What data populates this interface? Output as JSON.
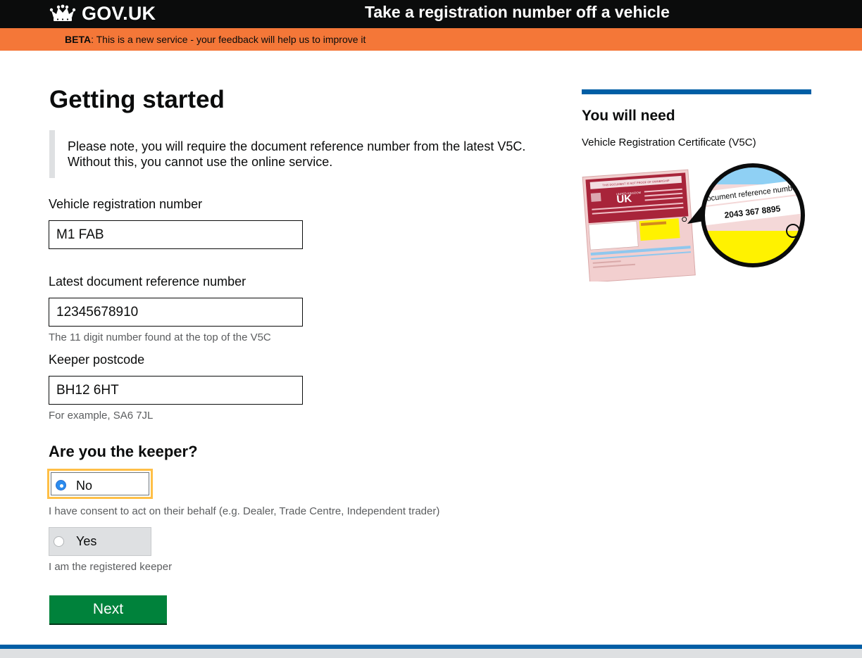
{
  "header": {
    "logo_text": "GOV.UK",
    "logo_icon": "crown-icon",
    "service_name": "Take a registration number off a vehicle"
  },
  "beta_banner": {
    "tag": "BETA",
    "message": ": This is a new service - your feedback will help us to improve it"
  },
  "main": {
    "title": "Getting started",
    "notice": "Please note, you will require the document reference number from the latest V5C. Without this, you cannot use the online service.",
    "fields": {
      "registration": {
        "label": "Vehicle registration number",
        "value": "M1 FAB"
      },
      "doc_ref": {
        "label": "Latest document reference number",
        "value": "12345678910",
        "hint": "The 11 digit number found at the top of the V5C"
      },
      "postcode": {
        "label": "Keeper postcode",
        "value": "BH12 6HT",
        "hint": "For example, SA6 7JL"
      }
    },
    "keeper": {
      "question": "Are you the keeper?",
      "options": [
        {
          "label": "No",
          "hint": "I have consent to act on their behalf (e.g. Dealer, Trade Centre, Independent trader)",
          "selected": true
        },
        {
          "label": "Yes",
          "hint": "I am the registered keeper",
          "selected": false
        }
      ]
    },
    "next_label": "Next"
  },
  "aside": {
    "title": "You will need",
    "item": "Vehicle Registration Certificate (V5C)",
    "image": {
      "header_text": "THIS DOCUMENT IS NOT PROOF OF OWNERSHIP",
      "country": "UK",
      "country_full": "UNITED KINGDOM",
      "zoom_label": "Document reference number",
      "zoom_number": "2043 367 8895"
    }
  },
  "colors": {
    "header_bg": "#0b0c0c",
    "beta_bg": "#f47738",
    "button_green": "#00823b",
    "aside_blue": "#005ea5",
    "focus_yellow": "#ffbf47"
  }
}
